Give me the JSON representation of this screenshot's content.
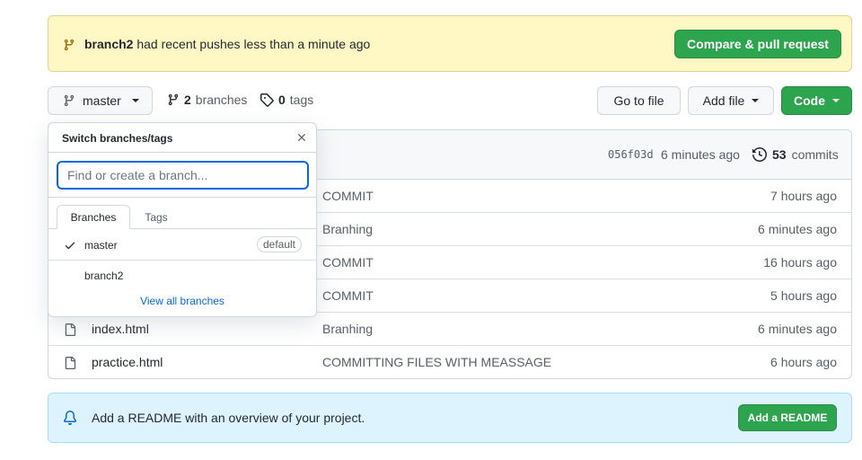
{
  "banner": {
    "branch": "branch2",
    "message": "had recent pushes less than a minute ago",
    "compare_button": "Compare & pull request",
    "bg_color": "#fff8c5"
  },
  "toolbar": {
    "current_branch": "master",
    "branches_count": "2",
    "branches_label": "branches",
    "tags_count": "0",
    "tags_label": "tags",
    "goto_file": "Go to file",
    "add_file": "Add file",
    "code": "Code"
  },
  "commit_header": {
    "sha": "056f03d",
    "time": "6 minutes ago",
    "commits_count": "53",
    "commits_label": "commits"
  },
  "files": [
    {
      "name": "",
      "message": "COMMIT",
      "time": "7 hours ago"
    },
    {
      "name": "",
      "message": "Branhing",
      "time": "6 minutes ago"
    },
    {
      "name": "",
      "message": "COMMIT",
      "time": "16 hours ago"
    },
    {
      "name": "",
      "message": "COMMIT",
      "time": "5 hours ago"
    },
    {
      "name": "index.html",
      "message": "Branhing",
      "time": "6 minutes ago"
    },
    {
      "name": "practice.html",
      "message": "COMMITTING FILES WITH MEASSAGE",
      "time": "6 hours ago"
    }
  ],
  "readme": {
    "message": "Add a README with an overview of your project.",
    "button": "Add a README"
  },
  "dropdown": {
    "title": "Switch branches/tags",
    "search_placeholder": "Find or create a branch...",
    "tabs": [
      "Branches",
      "Tags"
    ],
    "items": [
      {
        "name": "master",
        "badge": "default",
        "selected": true
      },
      {
        "name": "branch2",
        "badge": "",
        "selected": false
      }
    ],
    "view_all": "View all branches"
  },
  "colors": {
    "accent_green": "#2da44e",
    "link_blue": "#0969da",
    "readme_bg": "#ddf4ff"
  }
}
